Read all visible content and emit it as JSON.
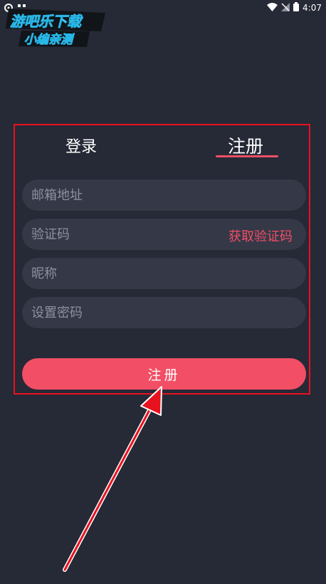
{
  "status_bar": {
    "time": "4:07",
    "icons": [
      "app-icon",
      "qr-icon",
      "wifi-icon",
      "no-signal-icon",
      "battery-icon"
    ]
  },
  "watermark": {
    "line1": "游吧乐下载",
    "line2": "小编亲测"
  },
  "tabs": {
    "login": "登录",
    "register": "注册",
    "active": "register"
  },
  "form": {
    "email_placeholder": "邮箱地址",
    "code_placeholder": "验证码",
    "get_code_label": "获取验证码",
    "nickname_placeholder": "昵称",
    "password_placeholder": "设置密码"
  },
  "register_button": "注册",
  "colors": {
    "background": "#262936",
    "field": "#343847",
    "accent": "#f24e66",
    "highlight": "#e8121f"
  }
}
